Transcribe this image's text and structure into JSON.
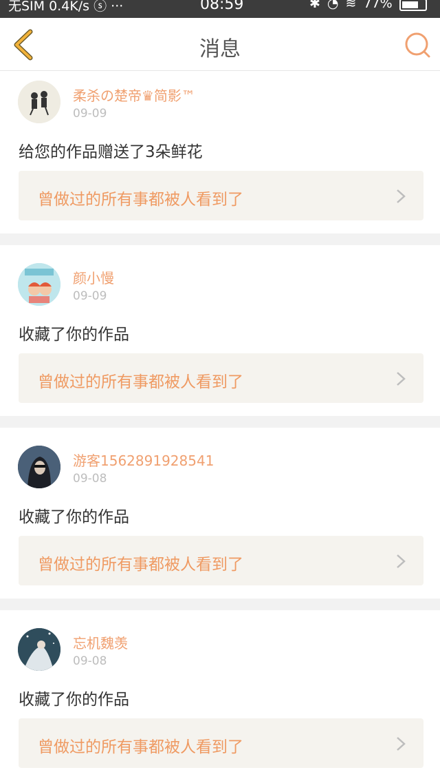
{
  "status_bar": {
    "left": "无SIM 0.4K/s ⓢ ···",
    "time": "08:59",
    "battery": "77%",
    "battery_level": 0.77
  },
  "header": {
    "title": "消息"
  },
  "messages": [
    {
      "username": "柔杀の楚帝♛简影™",
      "date": "09-09",
      "action": "给您的作品赠送了3朵鲜花",
      "work_title": "曾做过的所有事都被人看到了"
    },
    {
      "username": "颜小慢",
      "date": "09-09",
      "action": "收藏了你的作品",
      "work_title": "曾做过的所有事都被人看到了"
    },
    {
      "username": "游客1562891928541",
      "date": "09-08",
      "action": "收藏了你的作品",
      "work_title": "曾做过的所有事都被人看到了"
    },
    {
      "username": "忘机魏羡",
      "date": "09-08",
      "action": "收藏了你的作品",
      "work_title": "曾做过的所有事都被人看到了"
    }
  ],
  "colors": {
    "accent": "#f0a070",
    "back_icon": "#f2b23a",
    "link_bg": "#f5f3ee"
  }
}
